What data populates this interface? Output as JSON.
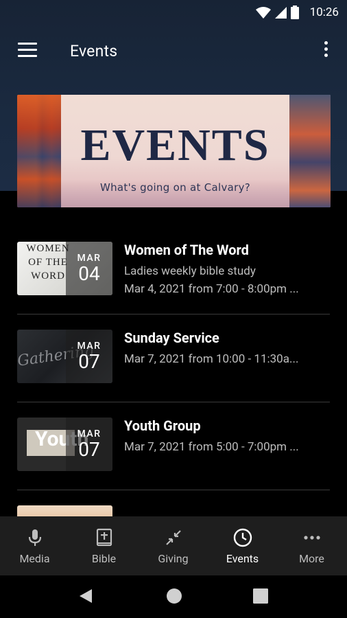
{
  "status_bar": {
    "time": "10:26"
  },
  "app_bar": {
    "title": "Events"
  },
  "banner": {
    "heading": "EVENTS",
    "tagline": "What's going on at Calvary?"
  },
  "events": [
    {
      "name": "Women of The Word",
      "description": "Ladies weekly bible study",
      "when": "Mar 4, 2021 from 7:00 - 8:00pm ...",
      "month": "MAR",
      "day": "04",
      "thumb_text": "WOMEN OF THE WORD"
    },
    {
      "name": "Sunday Service",
      "description": "",
      "when": "Mar 7, 2021 from 10:00 - 11:30a...",
      "month": "MAR",
      "day": "07",
      "thumb_text": "Gathering"
    },
    {
      "name": "Youth Group",
      "description": "",
      "when": "Mar 7, 2021 from 5:00 - 7:00pm ...",
      "month": "MAR",
      "day": "07",
      "thumb_text": "Youth"
    }
  ],
  "bottom_nav": [
    {
      "label": "Media",
      "icon": "mic-icon",
      "active": false
    },
    {
      "label": "Bible",
      "icon": "bible-icon",
      "active": false
    },
    {
      "label": "Giving",
      "icon": "giving-icon",
      "active": false
    },
    {
      "label": "Events",
      "icon": "clock-icon",
      "active": true
    },
    {
      "label": "More",
      "icon": "more-horiz-icon",
      "active": false
    }
  ],
  "colors": {
    "topbar_bg": "#1a2a40",
    "nav_bg": "#1e1e1e",
    "accent_text": "#ffffff",
    "muted_text": "#bdbdbd"
  }
}
